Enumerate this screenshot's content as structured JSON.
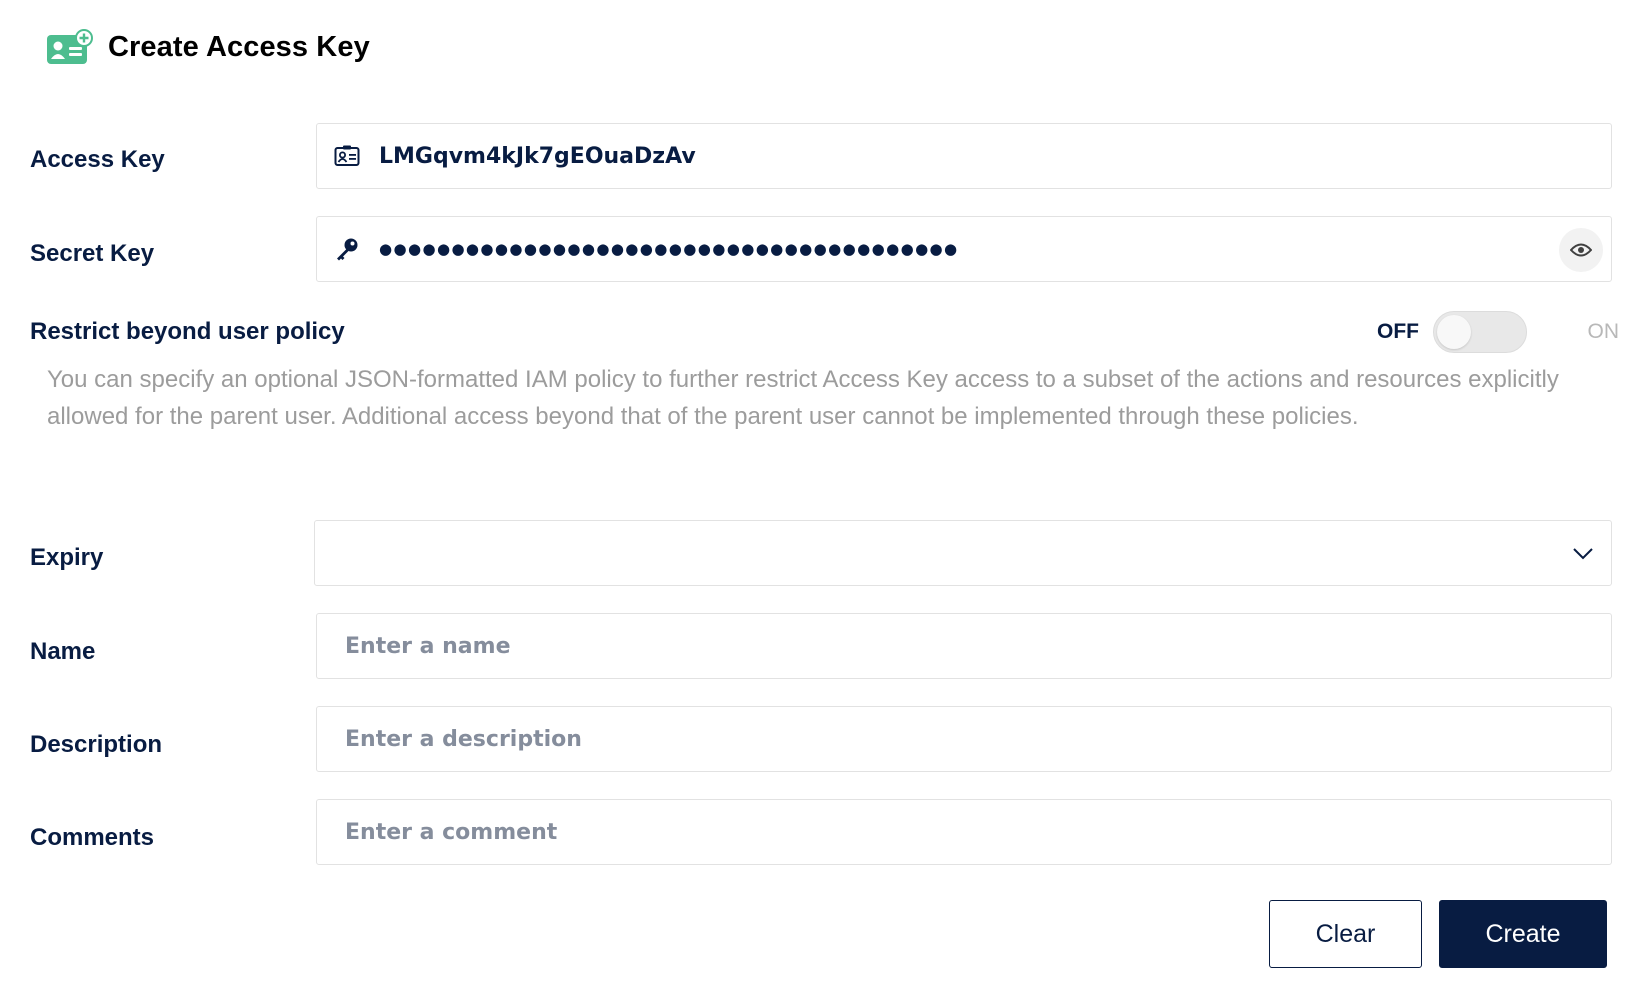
{
  "header": {
    "title": "Create Access Key",
    "icon": "add-user-card-icon",
    "icon_color": "#4dbd8f"
  },
  "access_key": {
    "label": "Access Key",
    "value": "LMGqvm4kJk7gEOuaDzAv",
    "icon": "id-card-icon"
  },
  "secret_key": {
    "label": "Secret Key",
    "masked_value": "●●●●●●●●●●●●●●●●●●●●●●●●●●●●●●●●●●●●●●●●",
    "icon": "key-icon",
    "toggle_icon": "eye-icon"
  },
  "restrict": {
    "label": "Restrict beyond user policy",
    "off_label": "OFF",
    "on_label": "ON",
    "enabled": false,
    "help": "You can specify an optional JSON-formatted IAM policy to further restrict Access Key access to a subset of the actions and resources explicitly allowed for the parent user. Additional access beyond that of the parent user cannot be implemented through these policies."
  },
  "expiry": {
    "label": "Expiry",
    "value": "",
    "icon": "chevron-down-icon"
  },
  "name": {
    "label": "Name",
    "placeholder": "Enter a name",
    "value": ""
  },
  "description": {
    "label": "Description",
    "placeholder": "Enter a description",
    "value": ""
  },
  "comments": {
    "label": "Comments",
    "placeholder": "Enter a comment",
    "value": ""
  },
  "actions": {
    "clear_label": "Clear",
    "create_label": "Create"
  },
  "colors": {
    "primary": "#081c42",
    "accent": "#4dbd8f",
    "muted_text": "#9c9c9c"
  }
}
